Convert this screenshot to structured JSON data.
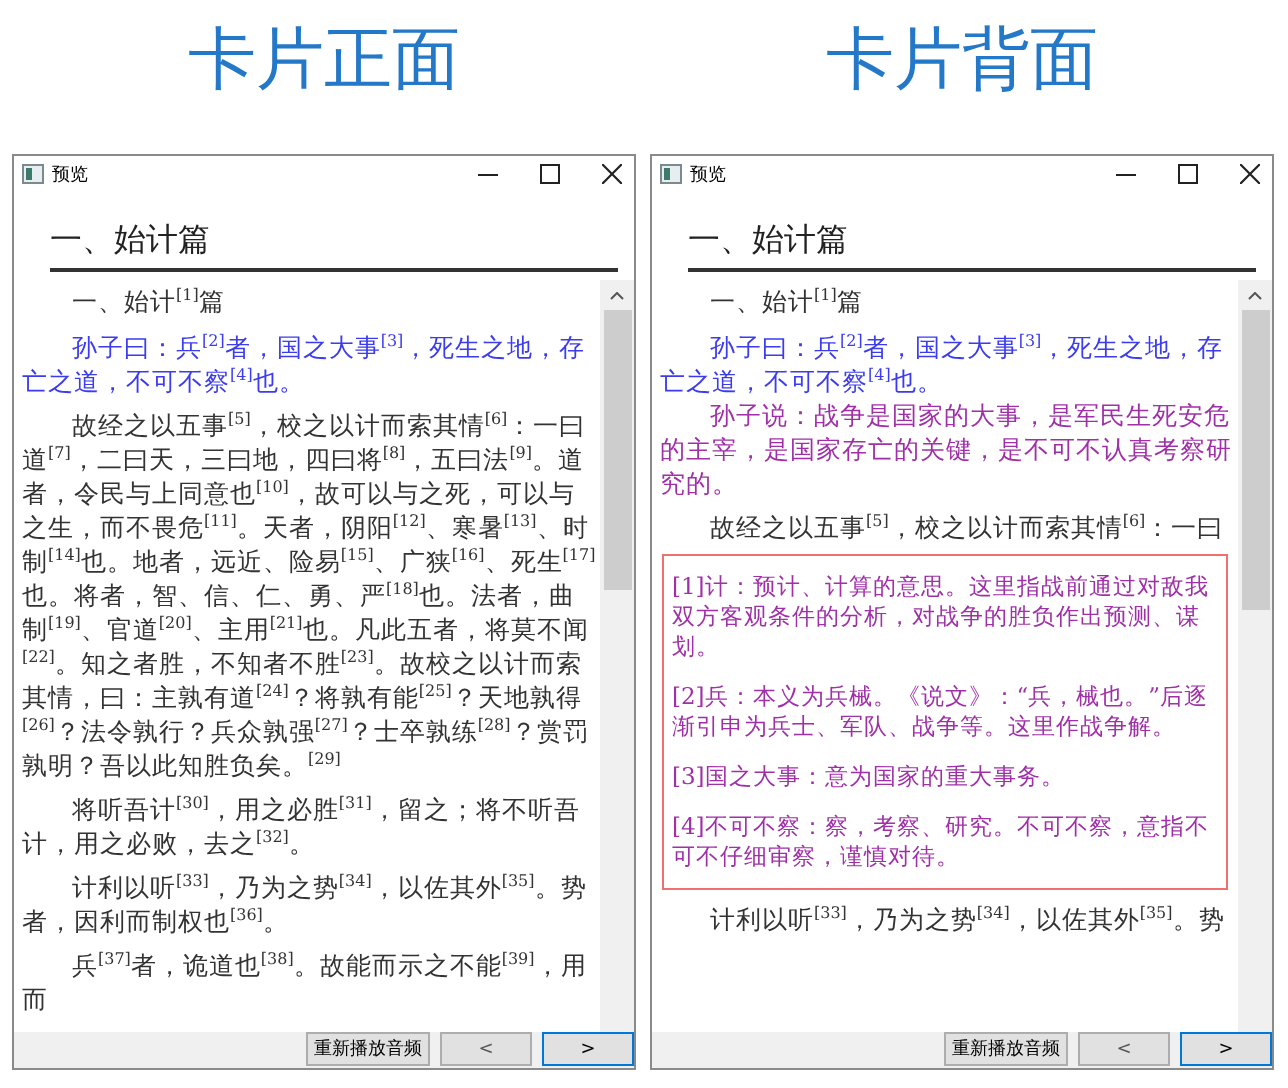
{
  "panes": [
    {
      "caption": "卡片正面",
      "window": {
        "title": "预览",
        "heading": "一、始计篇",
        "paragraphs": [
          {
            "kind": "title",
            "text": "一、始计$^{[1]}$篇"
          },
          {
            "kind": "original",
            "text": "孙子曰：兵$^{[2]}$者，国之大事$^{[3]}$，死生之地，存亡之道，不可不察$^{[4]}$也。"
          },
          {
            "kind": "text",
            "text": "故经之以五事$^{[5]}$，校之以计而索其情$^{[6]}$：一曰道$^{[7]}$，二曰天，三曰地，四曰将$^{[8]}$，五曰法$^{[9]}$。道者，令民与上同意也$^{[10]}$，故可以与之死，可以与之生，而不畏危$^{[11]}$。天者，阴阳$^{[12]}$、寒暑$^{[13]}$、时制$^{[14]}$也。地者，远近、险易$^{[15]}$、广狭$^{[16]}$、死生$^{[17]}$也。将者，智、信、仁、勇、严$^{[18]}$也。法者，曲制$^{[19]}$、官道$^{[20]}$、主用$^{[21]}$也。凡此五者，将莫不闻$^{[22]}$。知之者胜，不知者不胜$^{[23]}$。故校之以计而索其情，曰：主孰有道$^{[24]}$？将孰有能$^{[25]}$？天地孰得$^{[26]}$？法令孰行？兵众孰强$^{[27]}$？士卒孰练$^{[28]}$？赏罚孰明？吾以此知胜负矣。$^{[29]}$"
          },
          {
            "kind": "text",
            "text": "将听吾计$^{[30]}$，用之必胜$^{[31]}$，留之；将不听吾计，用之必败，去之$^{[32]}$。"
          },
          {
            "kind": "text",
            "text": "计利以听$^{[33]}$，乃为之势$^{[34]}$，以佐其外$^{[35]}$。势者，因利而制权也$^{[36]}$。"
          },
          {
            "kind": "text",
            "text": "兵$^{[37]}$者，诡道也$^{[38]}$。故能而示之不能$^{[39]}$，用而"
          }
        ],
        "buttons": [
          {
            "label": "重新播放音频",
            "kind": "action",
            "focused": false
          },
          {
            "label": "<",
            "kind": "nav",
            "focused": false
          },
          {
            "label": ">",
            "kind": "nav",
            "focused": true
          }
        ]
      }
    },
    {
      "caption": "卡片背面",
      "window": {
        "title": "预览",
        "heading": "一、始计篇",
        "paragraphs": [
          {
            "kind": "title",
            "text": "一、始计$^{[1]}$篇"
          },
          {
            "kind": "original",
            "text": "孙子曰：兵$^{[2]}$者，国之大事$^{[3]}$，死生之地，存亡之道，不可不察$^{[4]}$也。"
          },
          {
            "kind": "translation",
            "text": "孙子说：战争是国家的大事，是军民生死安危的主宰，是国家存亡的关键，是不可不认真考察研究的。"
          },
          {
            "kind": "text",
            "text": "故经之以五事$^{[5]}$，校之以计而索其情$^{[6]}$：一曰"
          },
          {
            "kind": "notes",
            "notes": [
              "[1]计：预计、计算的意思。这里指战前通过对敌我双方客观条件的分析，对战争的胜负作出预测、谋划。",
              "[2]兵：本义为兵械。《说文》：“兵，械也。”后逐渐引申为兵士、军队、战争等。这里作战争解。",
              "[3]国之大事：意为国家的重大事务。",
              "[4]不可不察：察，考察、研究。不可不察，意指不可不仔细审察，谨慎对待。"
            ]
          },
          {
            "kind": "text",
            "text": "计利以听$^{[33]}$，乃为之势$^{[34]}$，以佐其外$^{[35]}$。势"
          }
        ],
        "buttons": [
          {
            "label": "重新播放音频",
            "kind": "action",
            "focused": false
          },
          {
            "label": "<",
            "kind": "nav",
            "focused": false
          },
          {
            "label": ">",
            "kind": "nav",
            "focused": true
          }
        ]
      }
    }
  ]
}
